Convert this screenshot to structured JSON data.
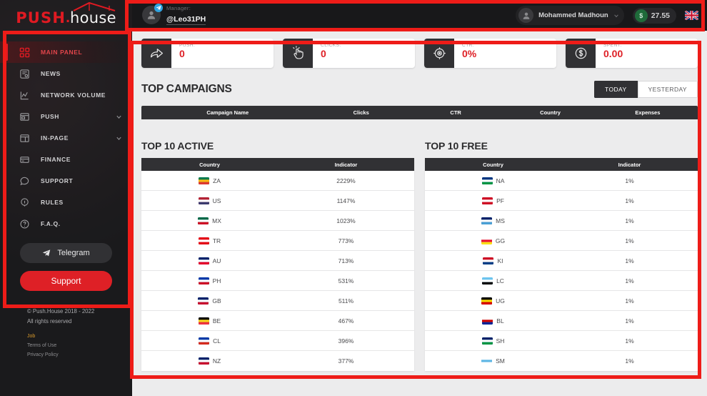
{
  "brand": {
    "logo_push": "PUSH",
    "logo_dot": ".",
    "logo_house": "house",
    "accent_red": "#de2026",
    "dark": "#1b1b1d"
  },
  "sidebar": {
    "items": [
      {
        "label": "MAIN PANEL",
        "icon": "grid-icon",
        "active": true,
        "chevron": false
      },
      {
        "label": "NEWS",
        "icon": "news-icon",
        "active": false,
        "chevron": false
      },
      {
        "label": "NETWORK VOLUME",
        "icon": "chart-icon",
        "active": false,
        "chevron": false
      },
      {
        "label": "PUSH",
        "icon": "window-icon",
        "active": false,
        "chevron": true
      },
      {
        "label": "IN-PAGE",
        "icon": "layout-icon",
        "active": false,
        "chevron": true
      },
      {
        "label": "FINANCE",
        "icon": "card-icon",
        "active": false,
        "chevron": false
      },
      {
        "label": "SUPPORT",
        "icon": "chat-icon",
        "active": false,
        "chevron": false
      },
      {
        "label": "RULES",
        "icon": "info-icon",
        "active": false,
        "chevron": false
      },
      {
        "label": "F.A.Q.",
        "icon": "question-icon",
        "active": false,
        "chevron": false
      }
    ],
    "telegram_button": "Telegram",
    "support_button": "Support",
    "footer": {
      "copyright": "© Push.House 2018 - 2022",
      "rights": "All rights reserved",
      "job": "Job",
      "terms": "Terms of Use",
      "privacy": "Privacy Policy"
    }
  },
  "topbar": {
    "manager_label": "Manager:",
    "manager_handle": "@Leo31PH",
    "user_name": "Mohammed Madhoun",
    "balance": "27.55",
    "currency_symbol": "$",
    "language_flag": "uk-flag-icon"
  },
  "stats": [
    {
      "label": "PUSH:",
      "value": "0",
      "icon": "share-arrow-icon"
    },
    {
      "label": "CLICKS:",
      "value": "0",
      "icon": "click-hand-icon"
    },
    {
      "label": "CTR:",
      "value": "0%",
      "icon": "target-icon"
    },
    {
      "label": "SPENT:",
      "value": "0.00",
      "icon": "dollar-coin-icon"
    }
  ],
  "campaigns": {
    "title": "TOP CAMPAIGNS",
    "toggle": {
      "today": "TODAY",
      "yesterday": "YESTERDAY",
      "selected": "TODAY"
    },
    "columns": [
      "Campaign Name",
      "Clicks",
      "CTR",
      "Country",
      "Expenses"
    ],
    "rows": []
  },
  "top_active": {
    "title": "TOP 10 ACTIVE",
    "columns": [
      "Country",
      "Indicator"
    ],
    "rows": [
      {
        "code": "ZA",
        "indicator": "2229%"
      },
      {
        "code": "US",
        "indicator": "1147%"
      },
      {
        "code": "MX",
        "indicator": "1023%"
      },
      {
        "code": "TR",
        "indicator": "773%"
      },
      {
        "code": "AU",
        "indicator": "713%"
      },
      {
        "code": "PH",
        "indicator": "531%"
      },
      {
        "code": "GB",
        "indicator": "511%"
      },
      {
        "code": "BE",
        "indicator": "467%"
      },
      {
        "code": "CL",
        "indicator": "396%"
      },
      {
        "code": "NZ",
        "indicator": "377%"
      }
    ]
  },
  "top_free": {
    "title": "TOP 10 FREE",
    "columns": [
      "Country",
      "Indicator"
    ],
    "rows": [
      {
        "code": "NA",
        "indicator": "1%"
      },
      {
        "code": "PF",
        "indicator": "1%"
      },
      {
        "code": "MS",
        "indicator": "1%"
      },
      {
        "code": "GG",
        "indicator": "1%"
      },
      {
        "code": "KI",
        "indicator": "1%"
      },
      {
        "code": "LC",
        "indicator": "1%"
      },
      {
        "code": "UG",
        "indicator": "1%"
      },
      {
        "code": "BL",
        "indicator": "1%"
      },
      {
        "code": "SH",
        "indicator": "1%"
      },
      {
        "code": "SM",
        "indicator": "1%"
      }
    ]
  },
  "flag_colors": {
    "ZA": [
      "#007a4d",
      "#ffb915",
      "#de3831"
    ],
    "US": [
      "#b22234",
      "#ffffff",
      "#3c3b6e"
    ],
    "MX": [
      "#006847",
      "#ffffff",
      "#ce1126"
    ],
    "TR": [
      "#e30a17",
      "#ffffff",
      "#e30a17"
    ],
    "AU": [
      "#012169",
      "#ffffff",
      "#e4002b"
    ],
    "PH": [
      "#0038a8",
      "#ffffff",
      "#ce1126"
    ],
    "GB": [
      "#012169",
      "#ffffff",
      "#c8102e"
    ],
    "BE": [
      "#000000",
      "#fdda24",
      "#ef3340"
    ],
    "CL": [
      "#0039a6",
      "#ffffff",
      "#d52b1e"
    ],
    "NZ": [
      "#012169",
      "#ffffff",
      "#c8102e"
    ],
    "NA": [
      "#003580",
      "#ffffff",
      "#009543"
    ],
    "PF": [
      "#ce1126",
      "#ffffff",
      "#ce1126"
    ],
    "MS": [
      "#012169",
      "#ffffff",
      "#4aa0d5"
    ],
    "GG": [
      "#ffffff",
      "#e8112d",
      "#f9dd16"
    ],
    "KI": [
      "#ce1126",
      "#ffffff",
      "#003f87"
    ],
    "LC": [
      "#6cc4ee",
      "#ffffff",
      "#000000"
    ],
    "UG": [
      "#000000",
      "#fcdc04",
      "#d90000"
    ],
    "BL": [
      "#ffffff",
      "#cc0000",
      "#002395"
    ],
    "SH": [
      "#012169",
      "#ffffff",
      "#009543"
    ],
    "SM": [
      "#ffffff",
      "#5eb6e4",
      "#ffffff"
    ]
  }
}
